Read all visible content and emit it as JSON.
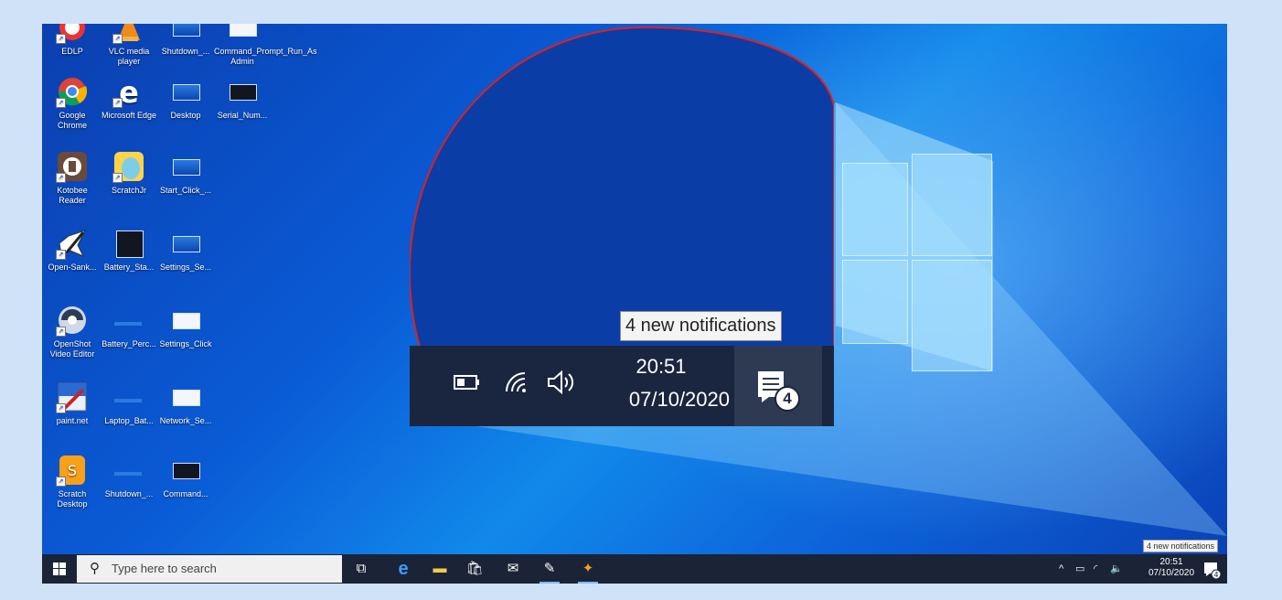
{
  "desktop": {
    "icons": [
      {
        "label": "EDLP"
      },
      {
        "label": "VLC media player"
      },
      {
        "label": "Shutdown_..."
      },
      {
        "label": "Command_Prompt_Run_As Admin"
      },
      {
        "label": "Google Chrome"
      },
      {
        "label": "Microsoft Edge"
      },
      {
        "label": "Desktop"
      },
      {
        "label": "Serial_Num..."
      },
      {
        "label": "Kotobee Reader"
      },
      {
        "label": "ScratchJr"
      },
      {
        "label": "Start_Click_..."
      },
      {
        "label": "Open-Sank..."
      },
      {
        "label": "Battery_Sta..."
      },
      {
        "label": "Settings_Se..."
      },
      {
        "label": "OpenShot Video Editor"
      },
      {
        "label": "Battery_Perc..."
      },
      {
        "label": "Settings_Click"
      },
      {
        "label": "paint.net"
      },
      {
        "label": "Laptop_Bat..."
      },
      {
        "label": "Network_Se..."
      },
      {
        "label": "Scratch Desktop"
      },
      {
        "label": "Shutdown_..."
      },
      {
        "label": "Command..."
      }
    ]
  },
  "magnifier": {
    "tooltip": "4 new notifications",
    "time": "20:51",
    "date": "07/10/2020",
    "badge": "4",
    "icons": [
      "battery-icon",
      "wifi-icon",
      "volume-icon",
      "action-center-icon"
    ]
  },
  "taskbar": {
    "search_placeholder": "Type here to search",
    "apps": [
      "task-view-icon",
      "edge-icon",
      "file-explorer-icon",
      "store-icon",
      "mail-icon",
      "paint-icon",
      "scratch-icon"
    ],
    "tray_chevron": "^",
    "time": "20:51",
    "date": "07/10/2020",
    "notif_badge": "4",
    "tooltip": "4 new notifications"
  },
  "colors": {
    "taskbar_bg": "#1a2436",
    "desktop_accent": "#0a5bd6",
    "outline_red": "#e0201c"
  }
}
